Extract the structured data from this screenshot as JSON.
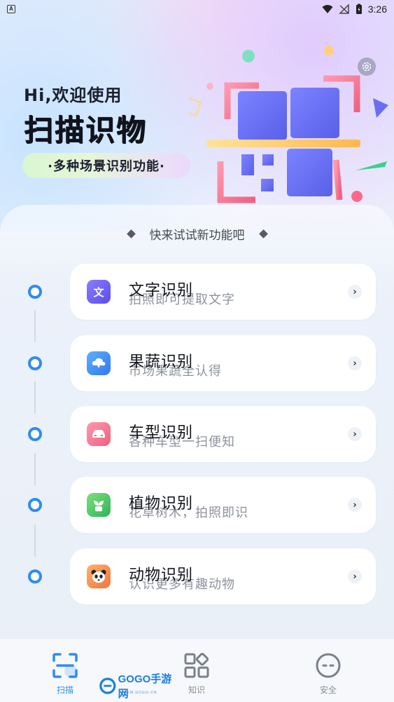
{
  "status_bar": {
    "time": "3:26"
  },
  "hero": {
    "greeting": "Hi,欢迎使用",
    "title": "扫描识物",
    "pill": "·多种场景识别功能·"
  },
  "section": {
    "header": "快来试试新功能吧"
  },
  "features": [
    {
      "title": "文字识别",
      "subtitle": "拍照即可提取文字",
      "icon": "text-icon",
      "icon_glyph": "文",
      "icon_color": "#6a5cf0"
    },
    {
      "title": "果蔬识别",
      "subtitle": "市场果蔬全认得",
      "icon": "cloud-icon",
      "icon_color": "#2f8cf0"
    },
    {
      "title": "车型识别",
      "subtitle": "各种车型一扫便知",
      "icon": "car-icon",
      "icon_color": "#f06a8a"
    },
    {
      "title": "植物识别",
      "subtitle": "花草树木，拍照即识",
      "icon": "plant-icon",
      "icon_color": "#3cc46a"
    },
    {
      "title": "动物识别",
      "subtitle": "认识更多有趣动物",
      "icon": "panda-icon",
      "icon_color": "#f28a3c"
    }
  ],
  "bottom_nav": [
    {
      "label": "扫描",
      "icon": "scan-icon",
      "active": true
    },
    {
      "label": "知识",
      "icon": "grid-icon",
      "active": false
    },
    {
      "label": "安全",
      "icon": "shield-face-icon",
      "active": false
    }
  ],
  "watermark": {
    "text": "GOGO手游网",
    "sub": "WWW.GOGO.CN"
  },
  "colors": {
    "accent": "#2f8cf0",
    "card": "#ffffff"
  }
}
